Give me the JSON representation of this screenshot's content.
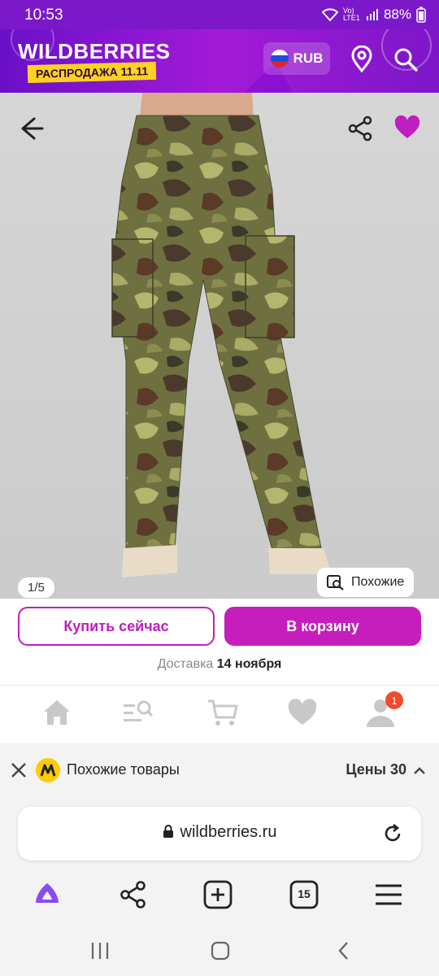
{
  "status_bar": {
    "time": "10:53",
    "battery": "88%",
    "net": "Vo) LTE1"
  },
  "header": {
    "brand": "WILDBERRIES",
    "sale": "РАСПРОДАЖА 11.11",
    "currency": "RUB"
  },
  "product": {
    "image_counter": "1/5",
    "similar_label": "Похожие"
  },
  "actions": {
    "buy_now": "Купить сейчас",
    "to_cart": "В корзину"
  },
  "delivery": {
    "label": "Доставка",
    "date": "14 ноября"
  },
  "nav": {
    "profile_badge": "1"
  },
  "yandex_bar": {
    "label": "Похожие товары",
    "prices_label": "Цены",
    "prices_count": "30"
  },
  "browser": {
    "url": "wildberries.ru",
    "tabs_count": "15"
  },
  "colors": {
    "accent": "#c51ebd",
    "header": "#7b18c9",
    "badge": "#f24b2b"
  }
}
